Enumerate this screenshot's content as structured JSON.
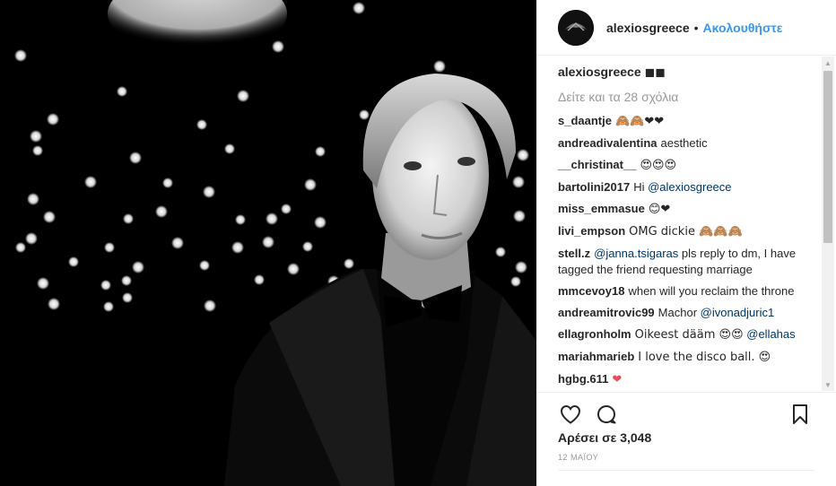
{
  "post": {
    "username": "alexiosgreece",
    "dot": "•",
    "follow_label": "Ακολουθήστε",
    "caption_user": "alexiosgreece",
    "caption_text": "◼◼",
    "load_more": "Δείτε και τα 28 σχόλια",
    "likes": "Αρέσει σε 3,048",
    "date": "12 ΜΑΪΟΥ"
  },
  "comments": [
    {
      "user": "s_daantje",
      "text": "🙈🙈❤❤"
    },
    {
      "user": "andreadivalentina",
      "text": "aesthetic"
    },
    {
      "user": "__christinat__",
      "text": "😍😍😍"
    },
    {
      "user": "bartolini2017",
      "text": "Hi",
      "mention": "@alexiosgreece"
    },
    {
      "user": "miss_emmasue",
      "text": "😊❤"
    },
    {
      "user": "livi_empson",
      "text": "OMG dickie 🙈🙈🙈"
    },
    {
      "user": "stell.z",
      "mention": "@janna.tsigaras",
      "text": "pls reply to dm, I have tagged the friend requesting marriage"
    },
    {
      "user": "mmcevoy18",
      "text": "when will you reclaim the throne"
    },
    {
      "user": "andreamitrovic99",
      "text": "Machor",
      "mention": "@ivonadjuric1"
    },
    {
      "user": "ellagronholm",
      "text": "Oikeest dääm 😍😍",
      "mention": "@ellahas"
    },
    {
      "user": "mariahmarieb",
      "text": "I love the disco ball. 😍"
    },
    {
      "user": "hgbg.611",
      "text": "❤"
    }
  ],
  "icons": {
    "like": "heart-icon",
    "comment": "comment-icon",
    "save": "bookmark-icon"
  },
  "colors": {
    "link": "#3897f0",
    "mention": "#003569",
    "muted": "#999999",
    "text": "#262626"
  }
}
